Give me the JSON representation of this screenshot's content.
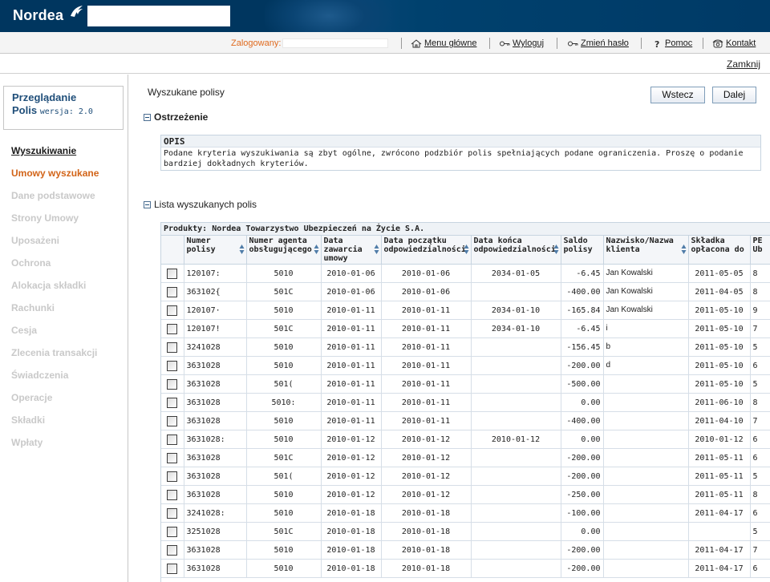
{
  "header": {
    "logo_text": "Nordea",
    "logged_label": "Zalogowany:",
    "nav": [
      {
        "label": "Menu główne",
        "icon": "home-icon"
      },
      {
        "label": "Wyloguj",
        "icon": "key-icon"
      },
      {
        "label": "Zmień hasło",
        "icon": "key-icon"
      },
      {
        "label": "Pomoc",
        "icon": "help-icon"
      },
      {
        "label": "Kontakt",
        "icon": "phone-icon"
      }
    ],
    "close_label": "Zamknij"
  },
  "sidebar": {
    "app_title_line1": "Przeglądanie",
    "app_title_line2": "Polis",
    "app_version": "wersja: 2.0",
    "items": [
      {
        "label": "Wyszukiwanie",
        "state": "active"
      },
      {
        "label": "Umowy wyszukane",
        "state": "current"
      },
      {
        "label": "Dane podstawowe",
        "state": "disabled"
      },
      {
        "label": "Strony Umowy",
        "state": "disabled"
      },
      {
        "label": "Uposażeni",
        "state": "disabled"
      },
      {
        "label": "Ochrona",
        "state": "disabled"
      },
      {
        "label": "Alokacja składki",
        "state": "disabled"
      },
      {
        "label": "Rachunki",
        "state": "disabled"
      },
      {
        "label": "Cesja",
        "state": "disabled"
      },
      {
        "label": "Zlecenia transakcji",
        "state": "disabled"
      },
      {
        "label": "Świadczenia",
        "state": "disabled"
      },
      {
        "label": "Operacje",
        "state": "disabled"
      },
      {
        "label": "Składki",
        "state": "disabled"
      },
      {
        "label": "Wpłaty",
        "state": "disabled"
      }
    ]
  },
  "main": {
    "page_title": "Wyszukane polisy",
    "back_button": "Wstecz",
    "next_button": "Dalej",
    "warning_section": "Ostrzeżenie",
    "warning_head": "OPIS",
    "warning_text": "Podane kryteria wyszukiwania są zbyt ogólne, zwrócono podzbiór polis spełniających podane ograniczenia. Proszę o podanie bardziej dokładnych kryteriów.",
    "list_section": "Lista wyszukanych polis",
    "product_label": "Produkty: Nordea Towarzystwo Ubezpieczeń na Życie S.A.",
    "columns": [
      "Numer polisy",
      "Numer agenta obsługującego",
      "Data zawarcia umowy",
      "Data początku odpowiedzialności",
      "Data końca odpowiedzialności",
      "Saldo polisy",
      "Nazwisko/Nazwa klienta",
      "Składka opłacona do",
      "PE Ub"
    ],
    "rows": [
      {
        "polisa": "120107:",
        "agent": "5010",
        "zawarcia": "2010-01-06",
        "poczatek": "2010-01-06",
        "koniec": "2034-01-05",
        "saldo": "-6.45",
        "klient": "Jan Kowalski",
        "skladka": "2011-05-05",
        "pe": "8"
      },
      {
        "polisa": "363102{",
        "agent": "501C",
        "zawarcia": "2010-01-06",
        "poczatek": "2010-01-06",
        "koniec": "",
        "saldo": "-400.00",
        "klient": "Jan Kowalski",
        "skladka": "2011-04-05",
        "pe": "8"
      },
      {
        "polisa": "120107·",
        "agent": "5010",
        "zawarcia": "2010-01-11",
        "poczatek": "2010-01-11",
        "koniec": "2034-01-10",
        "saldo": "-165.84",
        "klient": "Jan Kowalski",
        "skladka": "2011-05-10",
        "pe": "9"
      },
      {
        "polisa": "120107!",
        "agent": "501C",
        "zawarcia": "2010-01-11",
        "poczatek": "2010-01-11",
        "koniec": "2034-01-10",
        "saldo": "-6.45",
        "klient": "i",
        "skladka": "2011-05-10",
        "pe": "7"
      },
      {
        "polisa": "3241028",
        "agent": "5010",
        "zawarcia": "2010-01-11",
        "poczatek": "2010-01-11",
        "koniec": "",
        "saldo": "-156.45",
        "klient": "b",
        "skladka": "2011-05-10",
        "pe": "5"
      },
      {
        "polisa": "3631028",
        "agent": "5010",
        "zawarcia": "2010-01-11",
        "poczatek": "2010-01-11",
        "koniec": "",
        "saldo": "-200.00",
        "klient": "d",
        "skladka": "2011-05-10",
        "pe": "6"
      },
      {
        "polisa": "3631028",
        "agent": "501(",
        "zawarcia": "2010-01-11",
        "poczatek": "2010-01-11",
        "koniec": "",
        "saldo": "-500.00",
        "klient": "",
        "skladka": "2011-05-10",
        "pe": "5"
      },
      {
        "polisa": "3631028",
        "agent": "5010:",
        "zawarcia": "2010-01-11",
        "poczatek": "2010-01-11",
        "koniec": "",
        "saldo": "0.00",
        "klient": "",
        "skladka": "2011-06-10",
        "pe": "8"
      },
      {
        "polisa": "3631028",
        "agent": "5010",
        "zawarcia": "2010-01-11",
        "poczatek": "2010-01-11",
        "koniec": "",
        "saldo": "-400.00",
        "klient": "",
        "skladka": "2011-04-10",
        "pe": "7"
      },
      {
        "polisa": "3631028:",
        "agent": "5010",
        "zawarcia": "2010-01-12",
        "poczatek": "2010-01-12",
        "koniec": "2010-01-12",
        "saldo": "0.00",
        "klient": "",
        "skladka": "2010-01-12",
        "pe": "6"
      },
      {
        "polisa": "3631028",
        "agent": "501C",
        "zawarcia": "2010-01-12",
        "poczatek": "2010-01-12",
        "koniec": "",
        "saldo": "-200.00",
        "klient": "",
        "skladka": "2011-05-11",
        "pe": "6"
      },
      {
        "polisa": "3631028",
        "agent": "501(",
        "zawarcia": "2010-01-12",
        "poczatek": "2010-01-12",
        "koniec": "",
        "saldo": "-200.00",
        "klient": "",
        "skladka": "2011-05-11",
        "pe": "5"
      },
      {
        "polisa": "3631028",
        "agent": "5010",
        "zawarcia": "2010-01-12",
        "poczatek": "2010-01-12",
        "koniec": "",
        "saldo": "-250.00",
        "klient": "",
        "skladka": "2011-05-11",
        "pe": "8"
      },
      {
        "polisa": "3241028:",
        "agent": "5010",
        "zawarcia": "2010-01-18",
        "poczatek": "2010-01-18",
        "koniec": "",
        "saldo": "-100.00",
        "klient": "",
        "skladka": "2011-04-17",
        "pe": "6"
      },
      {
        "polisa": "3251028",
        "agent": "501C",
        "zawarcia": "2010-01-18",
        "poczatek": "2010-01-18",
        "koniec": "",
        "saldo": "0.00",
        "klient": "",
        "skladka": "",
        "pe": "5"
      },
      {
        "polisa": "3631028",
        "agent": "5010",
        "zawarcia": "2010-01-18",
        "poczatek": "2010-01-18",
        "koniec": "",
        "saldo": "-200.00",
        "klient": "",
        "skladka": "2011-04-17",
        "pe": "7"
      },
      {
        "polisa": "3631028",
        "agent": "5010",
        "zawarcia": "2010-01-18",
        "poczatek": "2010-01-18",
        "koniec": "",
        "saldo": "-200.00",
        "klient": "",
        "skladka": "2011-04-17",
        "pe": "6"
      }
    ]
  }
}
